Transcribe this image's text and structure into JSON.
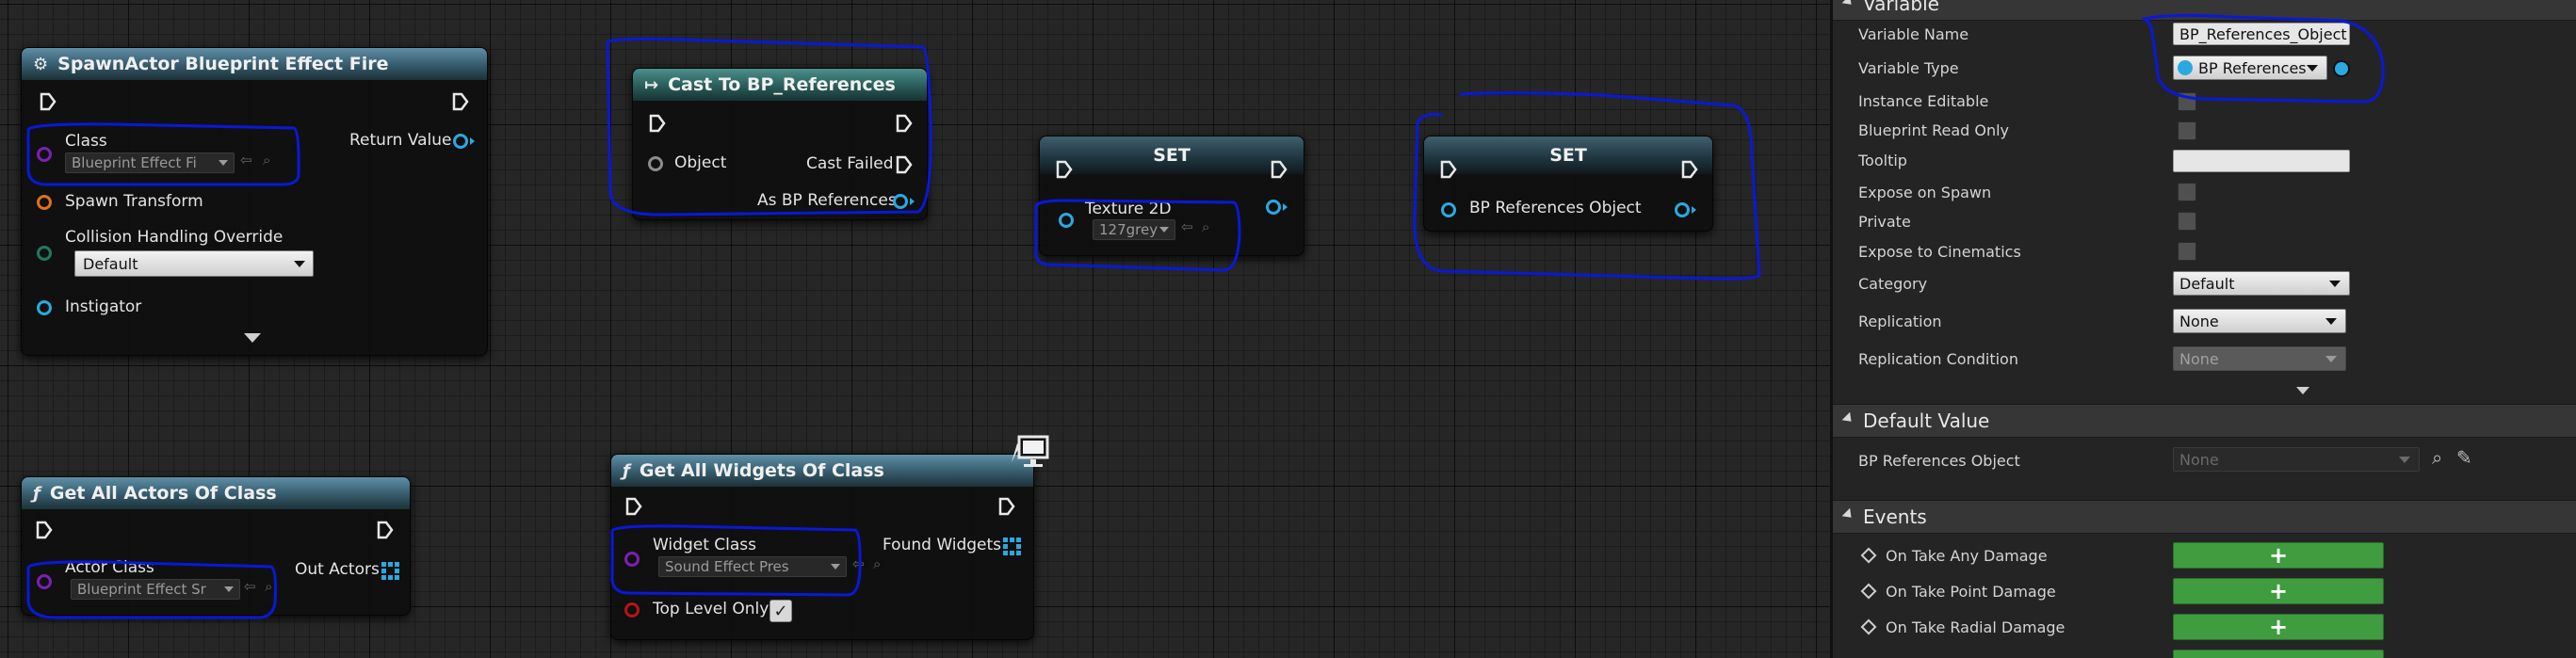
{
  "nodes": {
    "spawn": {
      "title": "SpawnActor Blueprint Effect Fire",
      "class_label": "Class",
      "class_value": "Blueprint Effect Fi",
      "return_label": "Return Value",
      "spawn_transform_label": "Spawn Transform",
      "collision_label": "Collision Handling Override",
      "collision_value": "Default",
      "instigator_label": "Instigator"
    },
    "cast": {
      "title": "Cast To BP_References",
      "object_label": "Object",
      "cast_failed_label": "Cast Failed",
      "as_label": "As BP References"
    },
    "set_texture": {
      "title": "SET",
      "pin_label": "Texture 2D",
      "pin_value": "127grey"
    },
    "set_ref": {
      "title": "SET",
      "pin_label": "BP References Object"
    },
    "get_actors": {
      "title": "Get All Actors Of Class",
      "actor_class_label": "Actor Class",
      "actor_class_value": "Blueprint Effect Sr",
      "out_label": "Out Actors"
    },
    "get_widgets": {
      "title": "Get All Widgets Of Class",
      "widget_class_label": "Widget Class",
      "widget_class_value": "Sound Effect Pres",
      "found_label": "Found Widgets",
      "top_level_label": "Top Level Only"
    }
  },
  "details": {
    "variable_section": "Variable",
    "rows": {
      "variable_name": {
        "label": "Variable Name",
        "value": "BP_References_Object"
      },
      "variable_type": {
        "label": "Variable Type",
        "value": "BP References"
      },
      "instance_editable": {
        "label": "Instance Editable"
      },
      "blueprint_read_only": {
        "label": "Blueprint Read Only"
      },
      "tooltip": {
        "label": "Tooltip",
        "value": ""
      },
      "expose_on_spawn": {
        "label": "Expose on Spawn"
      },
      "private": {
        "label": "Private"
      },
      "expose_cinematics": {
        "label": "Expose to Cinematics"
      },
      "category": {
        "label": "Category",
        "value": "Default"
      },
      "replication": {
        "label": "Replication",
        "value": "None"
      },
      "replication_condition": {
        "label": "Replication Condition",
        "value": "None"
      }
    },
    "default_section": "Default Value",
    "default_row": {
      "label": "BP References Object",
      "value": "None"
    },
    "events_section": "Events",
    "events": [
      {
        "label": "On Take Any Damage"
      },
      {
        "label": "On Take Point Damage"
      },
      {
        "label": "On Take Radial Damage"
      }
    ],
    "add_symbol": "+"
  },
  "colors": {
    "annotation": "#0a18d8",
    "object_pin": "#2aa9e0",
    "class_pin": "#7d1fb5",
    "add_button": "#3f9c3f"
  }
}
